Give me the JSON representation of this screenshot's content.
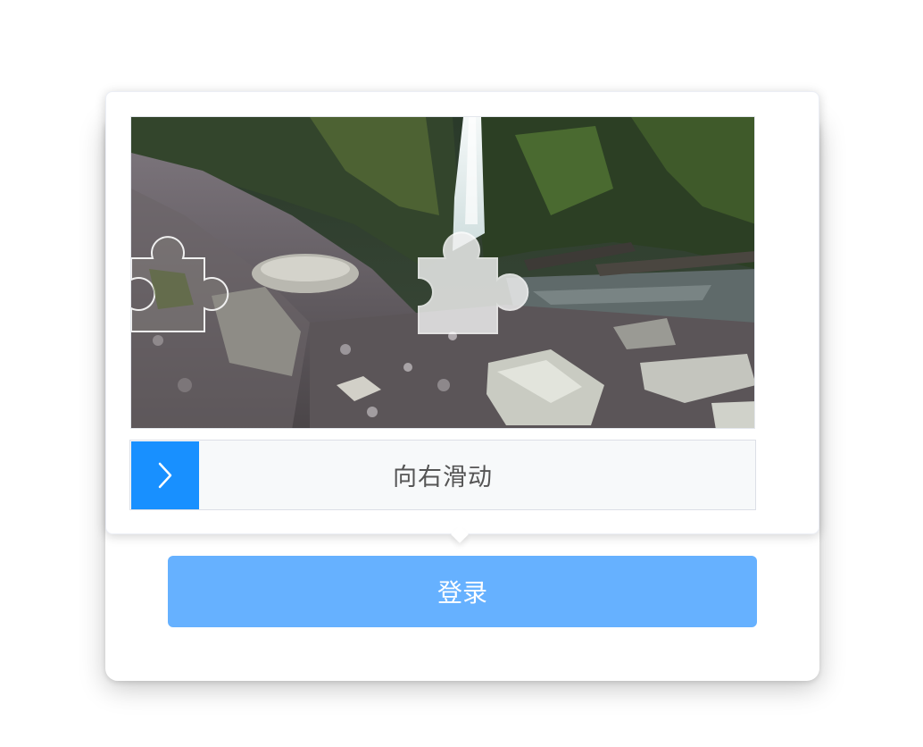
{
  "login": {
    "button_label": "登录"
  },
  "captcha": {
    "slider_text": "向右滑动",
    "handle_icon": "chevron-right-icon",
    "accent_color": "#1890ff",
    "button_color": "#66b1ff"
  }
}
